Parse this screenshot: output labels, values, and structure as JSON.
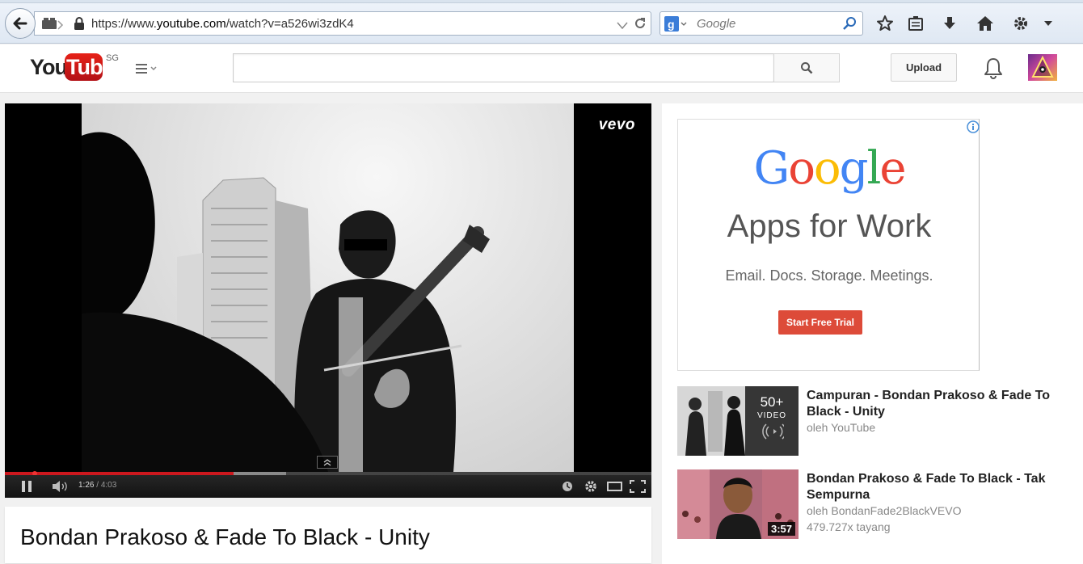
{
  "browser": {
    "url_scheme": "https://www.",
    "url_host": "youtube.com",
    "url_path": "/watch?v=a526wi3zdK4",
    "search_placeholder": "Google",
    "icons": [
      "back-arrow-icon",
      "tabs-icon",
      "lock-icon",
      "dropdown-arrow-icon",
      "reload-icon",
      "google-logo-icon",
      "magnifier-icon",
      "star-icon",
      "clipboard-icon",
      "download-icon",
      "home-icon",
      "gear-icon",
      "menu-arrow-icon"
    ]
  },
  "yt": {
    "logo_you": "You",
    "logo_tube": "Tube",
    "country": "SG",
    "upload_label": "Upload"
  },
  "player": {
    "brand": "vevo",
    "current_time": "1:26",
    "separator": " / ",
    "duration": "4:03",
    "played_fraction": 0.354,
    "buffered_fraction": 0.435
  },
  "video": {
    "title": "Bondan Prakoso & Fade To Black - Unity"
  },
  "ad": {
    "brand": "Google",
    "brand_colors": [
      "#4285f4",
      "#ea4335",
      "#fbbc05",
      "#4285f4",
      "#34a853",
      "#ea4335"
    ],
    "headline": "Apps for Work",
    "sub": "Email. Docs. Storage. Meetings.",
    "cta": "Start Free Trial",
    "cta_color": "#dd4b39"
  },
  "recommendations": [
    {
      "title": "Campuran - Bondan Prakoso & Fade To Black - Unity",
      "meta1": "oleh YouTube",
      "overlay_count": "50+",
      "overlay_label": "VIDEO"
    },
    {
      "title": "Bondan Prakoso & Fade To Black - Tak Sempurna",
      "meta1": "oleh BondanFade2BlackVEVO",
      "meta2": "479.727x tayang",
      "duration": "3:57"
    }
  ]
}
